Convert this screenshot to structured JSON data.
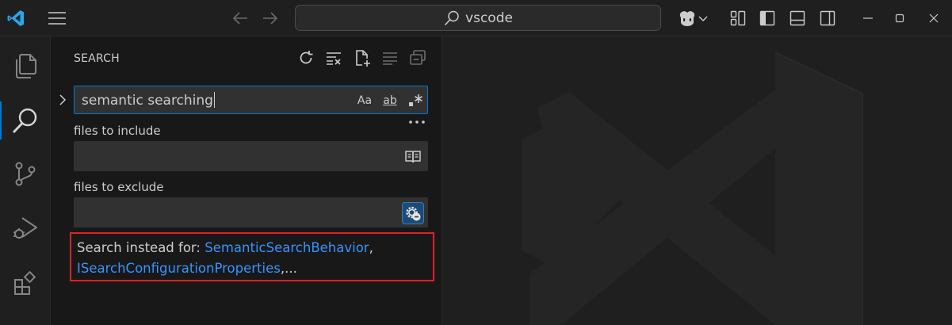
{
  "titlebar": {
    "command_center": "vscode"
  },
  "activity_bar": {
    "items": [
      "explorer",
      "search",
      "source-control",
      "run-and-debug",
      "extensions"
    ]
  },
  "sidebar": {
    "title": "SEARCH",
    "search": {
      "value": "semantic searching",
      "match_case_label": "Aa",
      "whole_word_label": "ab"
    },
    "include": {
      "label": "files to include",
      "value": ""
    },
    "exclude": {
      "label": "files to exclude",
      "value": ""
    },
    "suggestion": {
      "prefix": "Search instead for: ",
      "links": [
        "SemanticSearchBehavior",
        "ISearchConfigurationProperties"
      ],
      "separator": ",",
      "suffix": ",..."
    }
  },
  "colors": {
    "accent": "#0078d4",
    "link": "#3794ff",
    "highlight_border": "#e0202a",
    "logo": "#23a9f2"
  }
}
